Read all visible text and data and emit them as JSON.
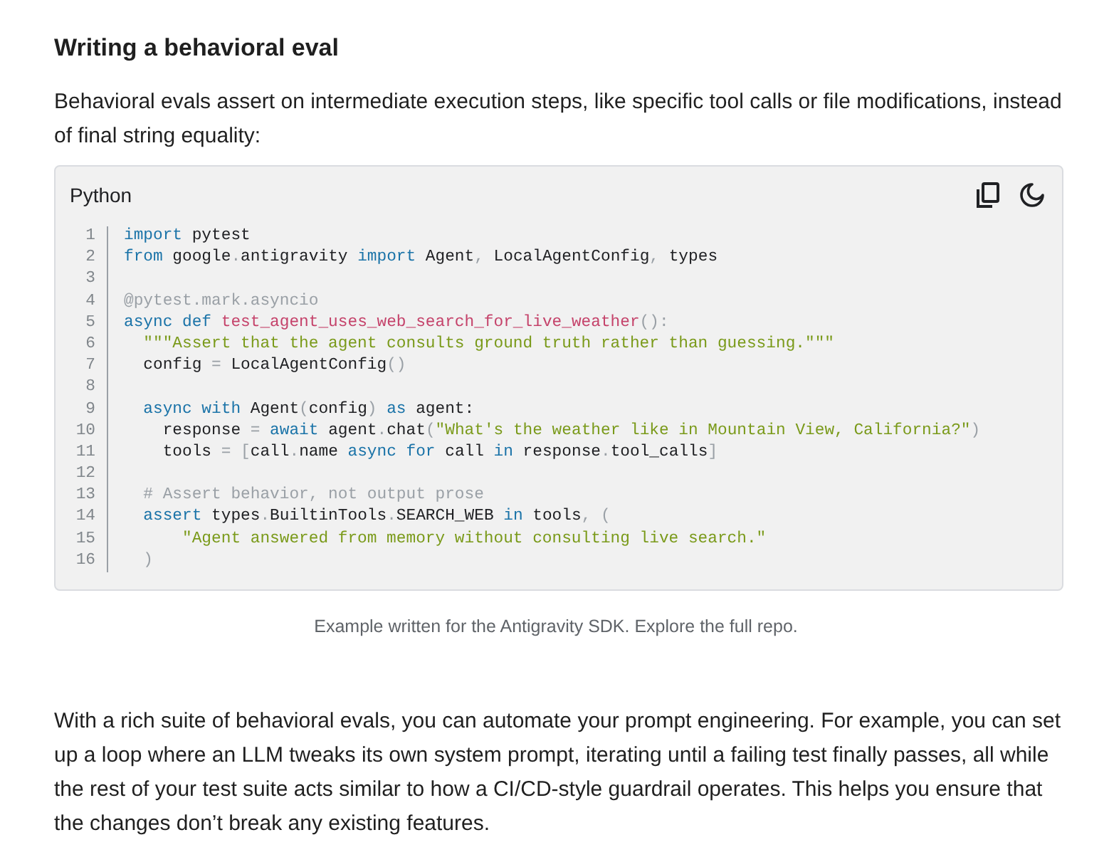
{
  "heading": "Writing a behavioral eval",
  "intro": "Behavioral evals assert on intermediate execution steps, like specific tool calls or file modifications, instead of final string equality:",
  "code_block": {
    "language": "Python",
    "lines": [
      {
        "number": "1",
        "tokens": [
          {
            "kind": "kw",
            "text": "import"
          },
          {
            "kind": "plain",
            "text": " pytest"
          }
        ]
      },
      {
        "number": "2",
        "tokens": [
          {
            "kind": "kw",
            "text": "from"
          },
          {
            "kind": "plain",
            "text": " google"
          },
          {
            "kind": "punct",
            "text": "."
          },
          {
            "kind": "plain",
            "text": "antigravity "
          },
          {
            "kind": "kw",
            "text": "import"
          },
          {
            "kind": "plain",
            "text": " Agent"
          },
          {
            "kind": "punct",
            "text": ","
          },
          {
            "kind": "plain",
            "text": " LocalAgentConfig"
          },
          {
            "kind": "punct",
            "text": ","
          },
          {
            "kind": "plain",
            "text": " types"
          }
        ]
      },
      {
        "number": "3"
      },
      {
        "number": "4",
        "tokens": [
          {
            "kind": "deco",
            "text": "@pytest.mark.asyncio"
          }
        ]
      },
      {
        "number": "5",
        "tokens": [
          {
            "kind": "kw",
            "text": "async def"
          },
          {
            "kind": "fn",
            "text": " test_agent_uses_web_search_for_live_weather"
          },
          {
            "kind": "punct",
            "text": "():"
          }
        ]
      },
      {
        "number": "6",
        "tokens": [
          {
            "kind": "str",
            "text": "  \"\"\"Assert that the agent consults ground truth rather than guessing.\"\"\""
          }
        ]
      },
      {
        "number": "7",
        "tokens": [
          {
            "kind": "plain",
            "text": "  config "
          },
          {
            "kind": "punct",
            "text": "="
          },
          {
            "kind": "plain",
            "text": " LocalAgentConfig"
          },
          {
            "kind": "punct",
            "text": "()"
          }
        ]
      },
      {
        "number": "8"
      },
      {
        "number": "9",
        "tokens": [
          {
            "kind": "kw",
            "text": "  async with"
          },
          {
            "kind": "plain",
            "text": " Agent"
          },
          {
            "kind": "punct",
            "text": "("
          },
          {
            "kind": "plain",
            "text": "config"
          },
          {
            "kind": "punct",
            "text": ") "
          },
          {
            "kind": "kw",
            "text": "as"
          },
          {
            "kind": "plain",
            "text": " agent:"
          }
        ]
      },
      {
        "number": "10",
        "tokens": [
          {
            "kind": "plain",
            "text": "    response "
          },
          {
            "kind": "punct",
            "text": "= "
          },
          {
            "kind": "kw",
            "text": "await"
          },
          {
            "kind": "plain",
            "text": " agent"
          },
          {
            "kind": "punct",
            "text": "."
          },
          {
            "kind": "plain",
            "text": "chat"
          },
          {
            "kind": "punct",
            "text": "("
          },
          {
            "kind": "str",
            "text": "\"What's the weather like in Mountain View, California?\""
          },
          {
            "kind": "punct",
            "text": ")"
          }
        ]
      },
      {
        "number": "11",
        "tokens": [
          {
            "kind": "plain",
            "text": "    tools "
          },
          {
            "kind": "punct",
            "text": "= ["
          },
          {
            "kind": "plain",
            "text": "call"
          },
          {
            "kind": "punct",
            "text": "."
          },
          {
            "kind": "plain",
            "text": "name "
          },
          {
            "kind": "kw",
            "text": "async for"
          },
          {
            "kind": "plain",
            "text": " call "
          },
          {
            "kind": "kw",
            "text": "in"
          },
          {
            "kind": "plain",
            "text": " response"
          },
          {
            "kind": "punct",
            "text": "."
          },
          {
            "kind": "plain",
            "text": "tool_calls"
          },
          {
            "kind": "punct",
            "text": "]"
          }
        ]
      },
      {
        "number": "12"
      },
      {
        "number": "13",
        "tokens": [
          {
            "kind": "comment",
            "text": "  # Assert behavior, not output prose"
          }
        ]
      },
      {
        "number": "14",
        "tokens": [
          {
            "kind": "kw",
            "text": "  assert"
          },
          {
            "kind": "plain",
            "text": " types"
          },
          {
            "kind": "punct",
            "text": "."
          },
          {
            "kind": "plain",
            "text": "BuiltinTools"
          },
          {
            "kind": "punct",
            "text": "."
          },
          {
            "kind": "plain",
            "text": "SEARCH_WEB "
          },
          {
            "kind": "kw",
            "text": "in"
          },
          {
            "kind": "plain",
            "text": " tools"
          },
          {
            "kind": "punct",
            "text": ", ("
          }
        ]
      },
      {
        "number": "15",
        "tokens": [
          {
            "kind": "str",
            "text": "      \"Agent answered from memory without consulting live search.\""
          }
        ]
      },
      {
        "number": "16",
        "tokens": [
          {
            "kind": "punct",
            "text": "  )"
          }
        ]
      }
    ]
  },
  "caption": "Example written for the Antigravity SDK. Explore the full repo.",
  "body": "With a rich suite of behavioral evals, you can automate your prompt engineering. For example, you can set up a loop where an LLM tweaks its own system prompt, iterating until a failing test finally passes, all while the rest of your test suite acts similar to how a CI/CD-style guardrail operates. This helps you ensure that the changes don’t break any existing features."
}
